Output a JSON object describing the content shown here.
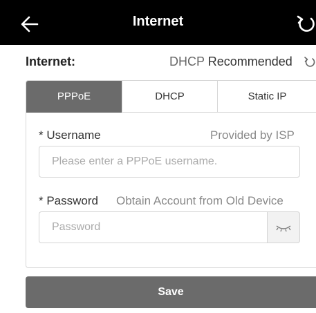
{
  "header": {
    "title": "Internet",
    "back_icon": "arrow-left-icon",
    "refresh_icon": "refresh-icon"
  },
  "internet": {
    "label": "Internet:",
    "mode": "DHCP",
    "recommended": "Recommended"
  },
  "tabs": [
    {
      "label": "PPPoE",
      "active": true
    },
    {
      "label": "DHCP",
      "active": false
    },
    {
      "label": "Static IP",
      "active": false
    }
  ],
  "username": {
    "label": "* Username",
    "hint": "Provided by ISP",
    "placeholder": "Please enter a PPPoE username."
  },
  "password": {
    "label": "* Password",
    "hint": "Obtain Account from Old Device",
    "placeholder": "Password",
    "toggle_icon": "eye-closed-icon"
  },
  "save_label": "Save",
  "colors": {
    "header_bg": "#000000",
    "active_tab": "#6b6b6b",
    "button_bg": "#6b6b6b"
  }
}
